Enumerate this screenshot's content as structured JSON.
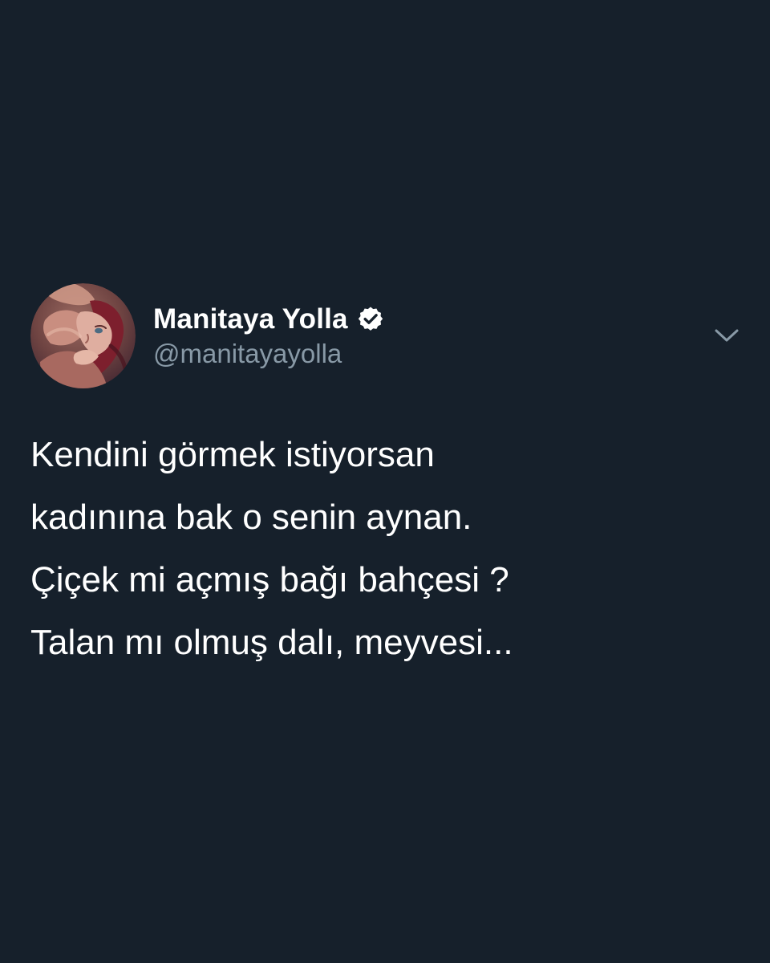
{
  "tweet": {
    "author": {
      "display_name": "Manitaya Yolla",
      "handle": "@manitayayolla",
      "verified_icon": "verified-badge-icon",
      "avatar_icon": "illustrated-couple-avatar"
    },
    "menu_icon": "chevron-down-icon",
    "text_lines": [
      "Kendini görmek istiyorsan",
      "kadınına bak o senin aynan.",
      "Çiçek mi açmış bağı bahçesi ?",
      "Talan mı olmuş dalı, meyvesi..."
    ]
  },
  "colors": {
    "background": "#16202b",
    "primary_text": "#ffffff",
    "secondary_text": "#8899a6",
    "chevron": "#8899a6"
  }
}
